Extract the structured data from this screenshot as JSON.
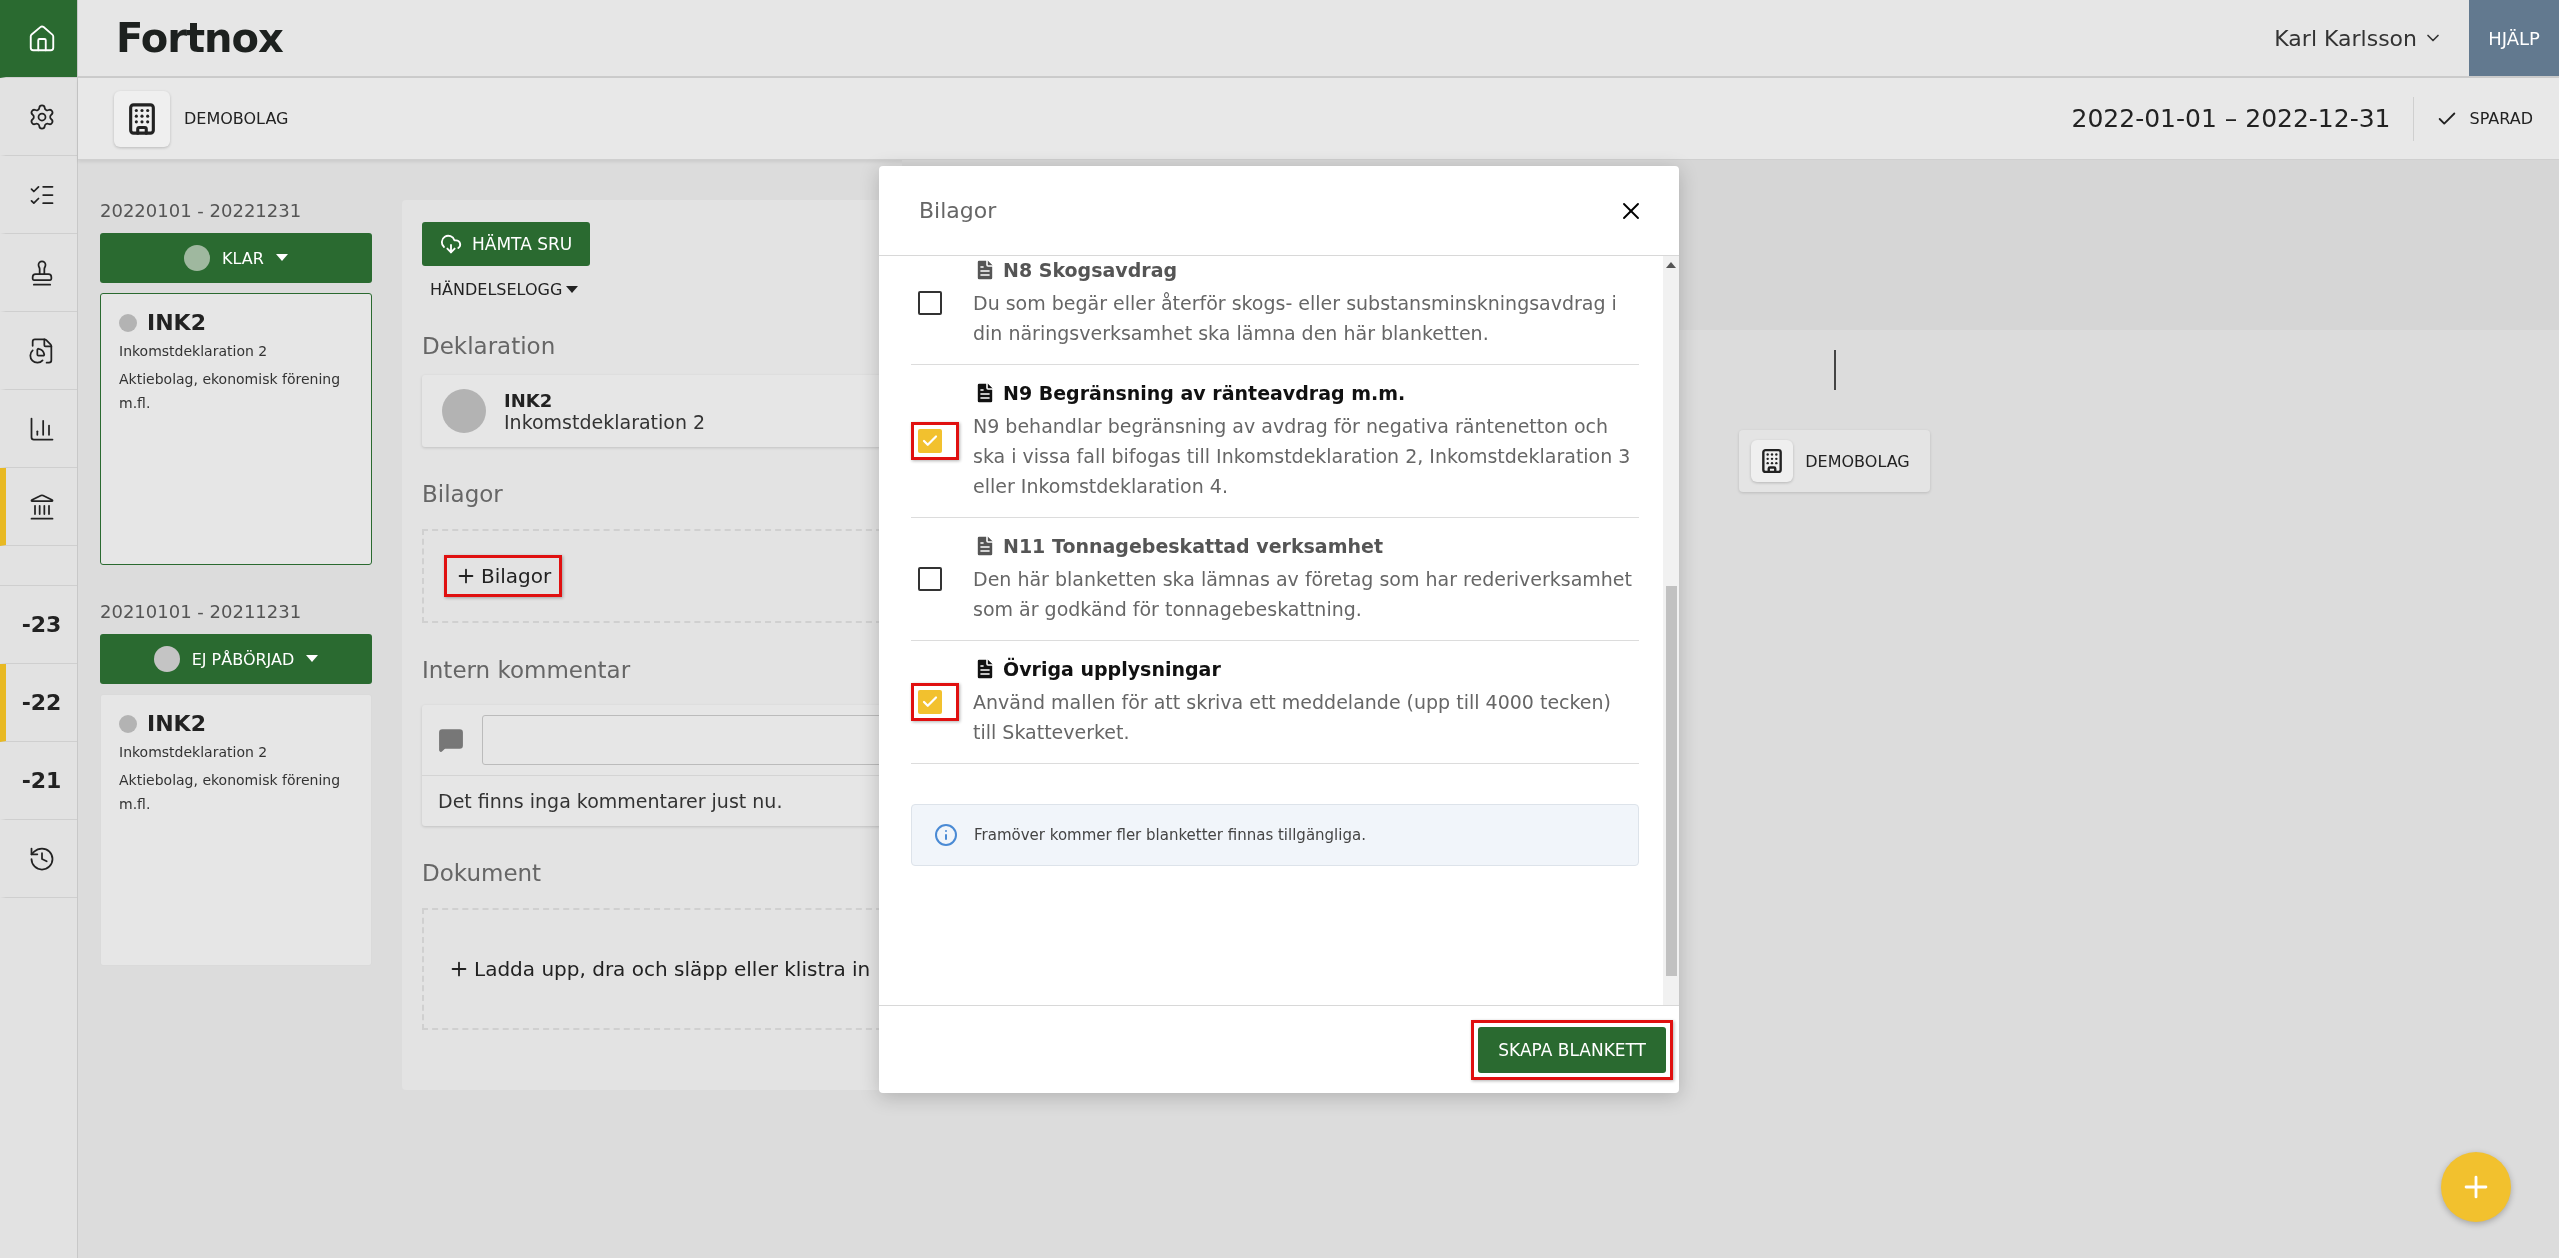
{
  "rail": {
    "items": [
      {
        "kind": "home",
        "active": false
      },
      {
        "kind": "icon",
        "active": false
      },
      {
        "kind": "icon",
        "active": false
      },
      {
        "kind": "icon",
        "active": false
      },
      {
        "kind": "icon",
        "active": false
      },
      {
        "kind": "icon",
        "active": false
      },
      {
        "kind": "icon",
        "active": true
      },
      {
        "kind": "gap"
      },
      {
        "kind": "year",
        "label": "-23",
        "active": false
      },
      {
        "kind": "year",
        "label": "-22",
        "active": true
      },
      {
        "kind": "year",
        "label": "-21",
        "active": false
      },
      {
        "kind": "icon",
        "active": false
      }
    ]
  },
  "header": {
    "logo": "Fortnox",
    "user": "Karl Karlsson",
    "help": "HJÄLP"
  },
  "subheader": {
    "company": "DEMOBOLAG",
    "period": "2022-01-01 – 2022-12-31",
    "save_status": "SPARAD"
  },
  "periods": [
    {
      "range": "20220101 - 20221231",
      "status": "KLAR",
      "color": "#9fb89f",
      "card": {
        "code": "INK2",
        "name": "Inkomstdeklaration 2",
        "description": "Aktiebolag, ekonomisk förening m.fl.",
        "selected": true
      }
    },
    {
      "range": "20210101 - 20211231",
      "status": "EJ PÅBÖRJAD",
      "color": "#c4c4c4",
      "card": {
        "code": "INK2",
        "name": "Inkomstdeklaration 2",
        "description": "Aktiebolag, ekonomisk förening m.fl.",
        "selected": false
      }
    }
  ],
  "panel": {
    "sru_button": "HÄMTA SRU",
    "log_dropdown": "HÄNDELSELOGG",
    "declaration_heading": "Deklaration",
    "declaration": {
      "code": "INK2",
      "name": "Inkomstdeklaration 2"
    },
    "attachments_heading": "Bilagor",
    "add_attachment": {
      "label": "Bilagor",
      "highlighted": true
    },
    "comment_heading": "Intern kommentar",
    "no_comments": "Det finns inga kommentarer just nu.",
    "documents_heading": "Dokument",
    "upload_label": "Ladda upp, dra och släpp eller klistra in"
  },
  "tree": {
    "node": "DEMOBOLAG"
  },
  "modal": {
    "title": "Bilagor",
    "items": [
      {
        "title": "N8 Skogsavdrag",
        "description": "Du som begär eller återför skogs- eller substansminskningsavdrag i din näringsverksamhet ska lämna den här blanketten.",
        "checked": false,
        "highlighted": false
      },
      {
        "title": "N9 Begränsning av ränteavdrag m.m.",
        "description": "N9 behandlar begränsning av avdrag för negativa räntenetton och ska i vissa fall bifogas till Inkomstdeklaration 2, Inkomstdeklaration 3 eller Inkomstdeklaration 4.",
        "checked": true,
        "highlighted": true
      },
      {
        "title": "N11 Tonnagebeskattad verksamhet",
        "description": "Den här blanketten ska lämnas av företag som har rederiverksamhet som är godkänd för tonnagebeskattning.",
        "checked": false,
        "highlighted": false
      },
      {
        "title": "Övriga upplysningar",
        "description": "Använd mallen för att skriva ett meddelande (upp till 4000 tecken) till Skatteverket.",
        "checked": true,
        "highlighted": true
      }
    ],
    "info": "Framöver kommer fler blanketter finnas tillgängliga.",
    "submit": {
      "label": "SKAPA BLANKETT",
      "highlighted": true
    }
  }
}
